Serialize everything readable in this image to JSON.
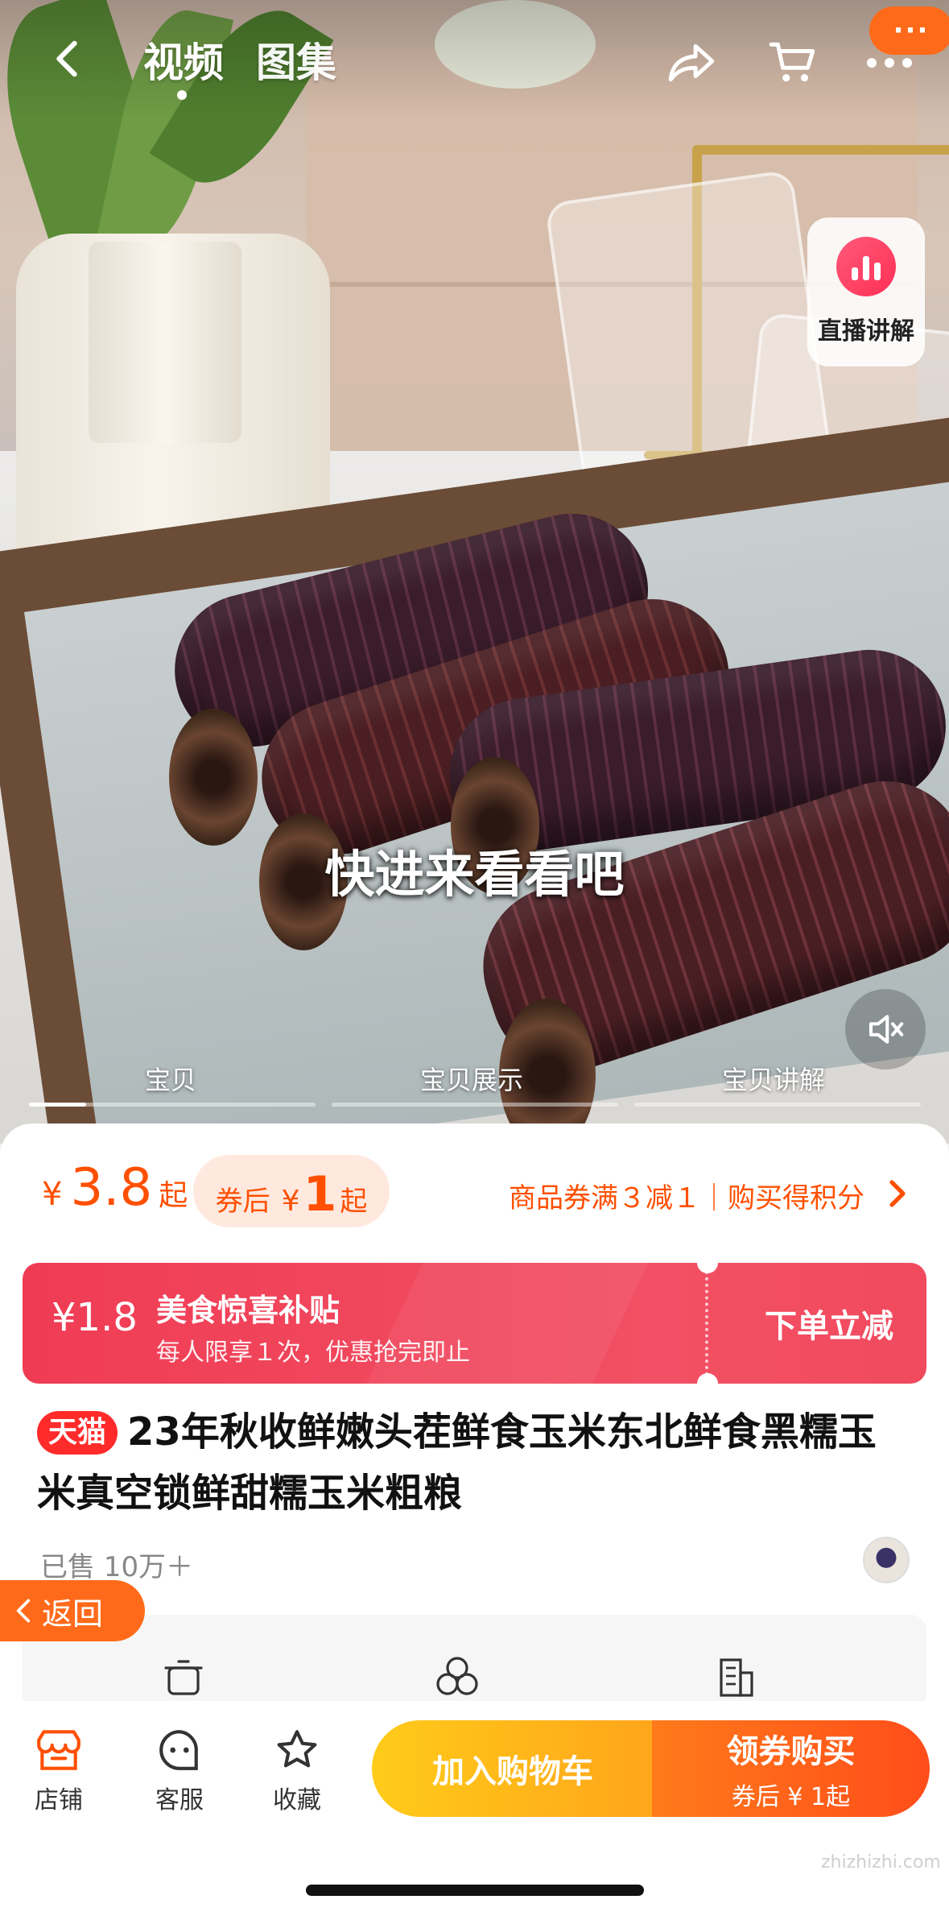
{
  "nav": {
    "tabs": [
      "视频",
      "图集"
    ],
    "active_tab": 0,
    "more_badge": "···"
  },
  "media": {
    "live_button_label": "直播讲解",
    "caption": "快进来看看吧",
    "segments": [
      {
        "label": "宝贝",
        "progress": 0.2
      },
      {
        "label": "宝贝展示",
        "progress": 0
      },
      {
        "label": "宝贝讲解",
        "progress": 0
      }
    ]
  },
  "price": {
    "symbol": "¥",
    "value": "3.8",
    "suffix": "起",
    "coupon_label": "券后",
    "coupon_symbol": "¥",
    "coupon_value": "1",
    "coupon_suffix": "起",
    "promo_text": "商品券满３减１｜购买得积分"
  },
  "subsidy": {
    "amount": "¥1.8",
    "title": "美食惊喜补贴",
    "description": "每人限享１次，优惠抢完即止",
    "action": "下单立减"
  },
  "product": {
    "badge": "天猫",
    "title": "23年秋收鲜嫩头茬鲜食玉米东北鲜食黑糯玉米真空锁鲜甜糯玉米粗粮",
    "sold": "已售 10万＋"
  },
  "float_back_label": "返回",
  "bottom_bar": {
    "shop": "店铺",
    "service": "客服",
    "favorite": "收藏",
    "add_to_cart": "加入购物车",
    "buy_main": "领券购买",
    "buy_sub": "券后 ¥ 1起"
  },
  "colors": {
    "accent": "#ff5000",
    "subsidy_red": "#ef3c54",
    "tmall_red": "#ff2a2a",
    "cart_yellow": "#ffb81a",
    "buy_orange": "#ff5a1a"
  },
  "watermark": "zhizhizhi.com"
}
